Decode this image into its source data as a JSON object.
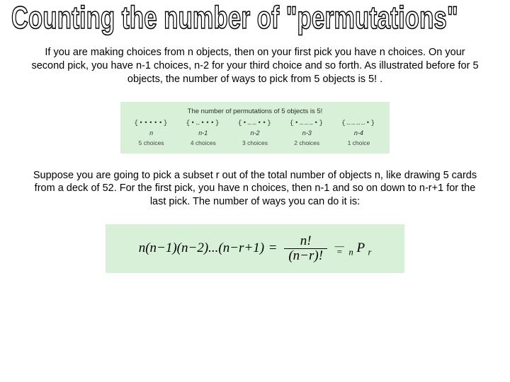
{
  "title": "Counting the number of \"permutations\"",
  "para1": "If you are making choices from n objects, then on your first pick you have n choices. On your second pick, you have n-1 choices, n-2 for your third choice and so forth. As illustrated before for 5 objects, the number of ways to pick from 5 objects is 5! .",
  "panel1": {
    "title": "The number of permutations of 5 objects is 5!",
    "groups": [
      {
        "vis": "{•••••}",
        "var": "n",
        "note": "5 choices"
      },
      {
        "vis": "{•…•••}",
        "var": "n-1",
        "note": "4 choices"
      },
      {
        "vis": "{•……••}",
        "var": "n-2",
        "note": "3 choices"
      },
      {
        "vis": "{•………•}",
        "var": "n-3",
        "note": "2 choices"
      },
      {
        "vis": "{…………•}",
        "var": "n-4",
        "note": "1 choice"
      }
    ]
  },
  "para2": "Suppose you are going to pick a subset r out of the total number of objects n, like drawing 5 cards from a deck of 52.   For the first pick, you have n choices, then n-1 and so on down to n-r+1 for the last pick. The number of ways you can do it is:",
  "formula": {
    "lhs": "n(n−1)(n−2)...(n−r+1)",
    "frac_num": "n!",
    "frac_den": "(n−r)!",
    "rhs_symbol_sub1": "n",
    "rhs_symbol_main": "P",
    "rhs_symbol_sub2": "r"
  }
}
